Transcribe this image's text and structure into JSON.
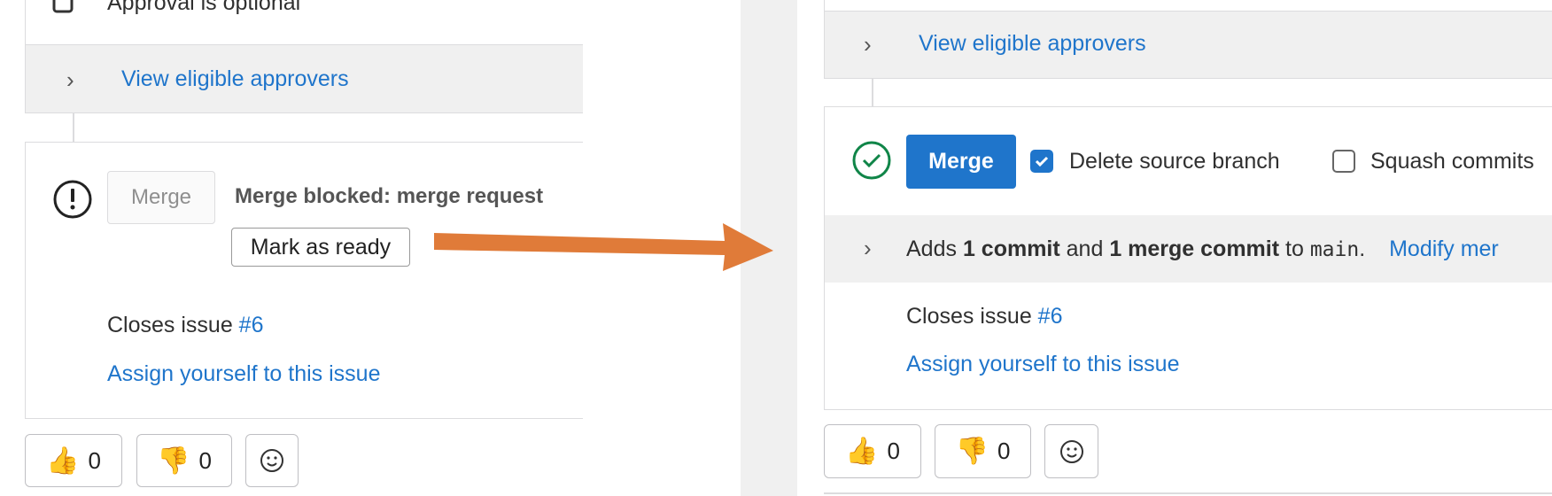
{
  "colors": {
    "accent": "#1f75cb",
    "arrow": "#e07b39",
    "success": "#108548"
  },
  "left": {
    "approval_text": "Approval is optional",
    "view_eligible": "View eligible approvers",
    "merge_button": "Merge",
    "blocked_text": "Merge blocked: merge request",
    "mark_ready": "Mark as ready",
    "closes_issue_prefix": "Closes issue ",
    "closes_issue_link": "#6",
    "assign_link": "Assign yourself to this issue",
    "reactions": {
      "thumbs_up_count": "0",
      "thumbs_down_count": "0"
    }
  },
  "right": {
    "view_eligible": "View eligible approvers",
    "merge_button": "Merge",
    "delete_source_branch": "Delete source branch",
    "delete_source_checked": true,
    "squash_commits": "Squash commits",
    "squash_checked": false,
    "adds_prefix": "Adds ",
    "adds_commit": "1 commit",
    "adds_and": " and ",
    "adds_merge_commit": "1 merge commit",
    "adds_to": " to ",
    "adds_branch": "main",
    "adds_period": ".",
    "modify_link": "Modify mer",
    "closes_issue_prefix": "Closes issue ",
    "closes_issue_link": "#6",
    "assign_link": "Assign yourself to this issue",
    "reactions": {
      "thumbs_up_count": "0",
      "thumbs_down_count": "0"
    }
  },
  "icons": [
    "lock-icon",
    "chevron-right-icon",
    "warning-icon",
    "check-circle-icon",
    "thumbs-up-icon",
    "thumbs-down-icon",
    "smiley-icon",
    "arrow-icon"
  ]
}
